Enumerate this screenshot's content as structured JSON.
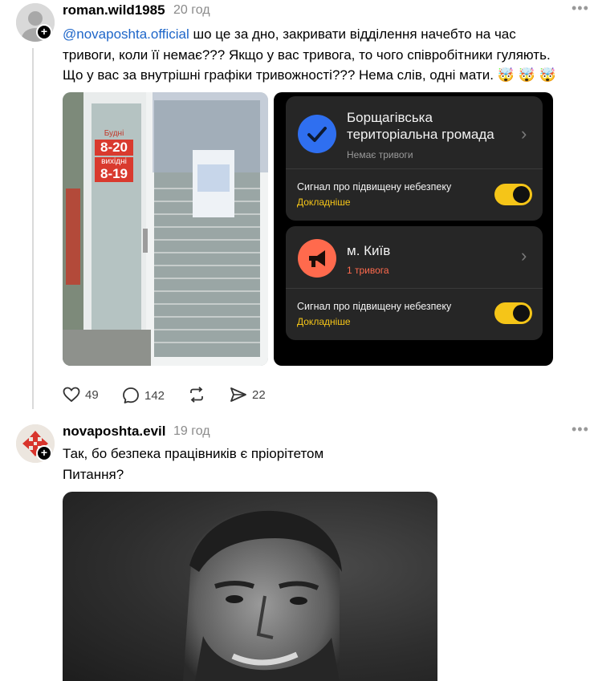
{
  "post1": {
    "username": "roman.wild1985",
    "time": "20 год",
    "mention": "@novaposhta.official",
    "text_line1_rest": " шо це за дно, закривати відділення начебто на час",
    "text_line2": "тривоги, коли її немає??? Якщо у вас тривога, то чого співробітники гуляють.",
    "text_line3": "Що у вас за внутрішні графіки тривожності??? Нема слів, одні мати. 🤯 🤯 🤯",
    "door_photo": {
      "days_label": "Будні",
      "days_hours": "8-20",
      "weekend_label": "вихідні",
      "weekend_hours": "8-19"
    },
    "app": {
      "card1": {
        "title_line1": "Борщагівська",
        "title_line2": "територіальна громада",
        "status": "Немає тривоги",
        "icon": "check-circle-icon",
        "icon_color": "#2f6ff0",
        "signal_label": "Сигнал про підвищену небезпеку",
        "signal_link": "Докладніше"
      },
      "card2": {
        "title": "м. Київ",
        "status": "1 тривога",
        "status_color": "#ff6a4d",
        "icon": "megaphone-icon",
        "icon_color": "#ff6a4d",
        "signal_label": "Сигнал про підвищену небезпеку",
        "signal_link": "Докладніше"
      },
      "toggle_color": "#f5c518"
    },
    "actions": {
      "likes": "49",
      "comments": "142",
      "shares": "22"
    }
  },
  "post2": {
    "username": "novaposhta.evil",
    "time": "19 год",
    "text_line1": "Так, бо безпека працівників є пріорітетом",
    "text_line2": "Питання?"
  }
}
